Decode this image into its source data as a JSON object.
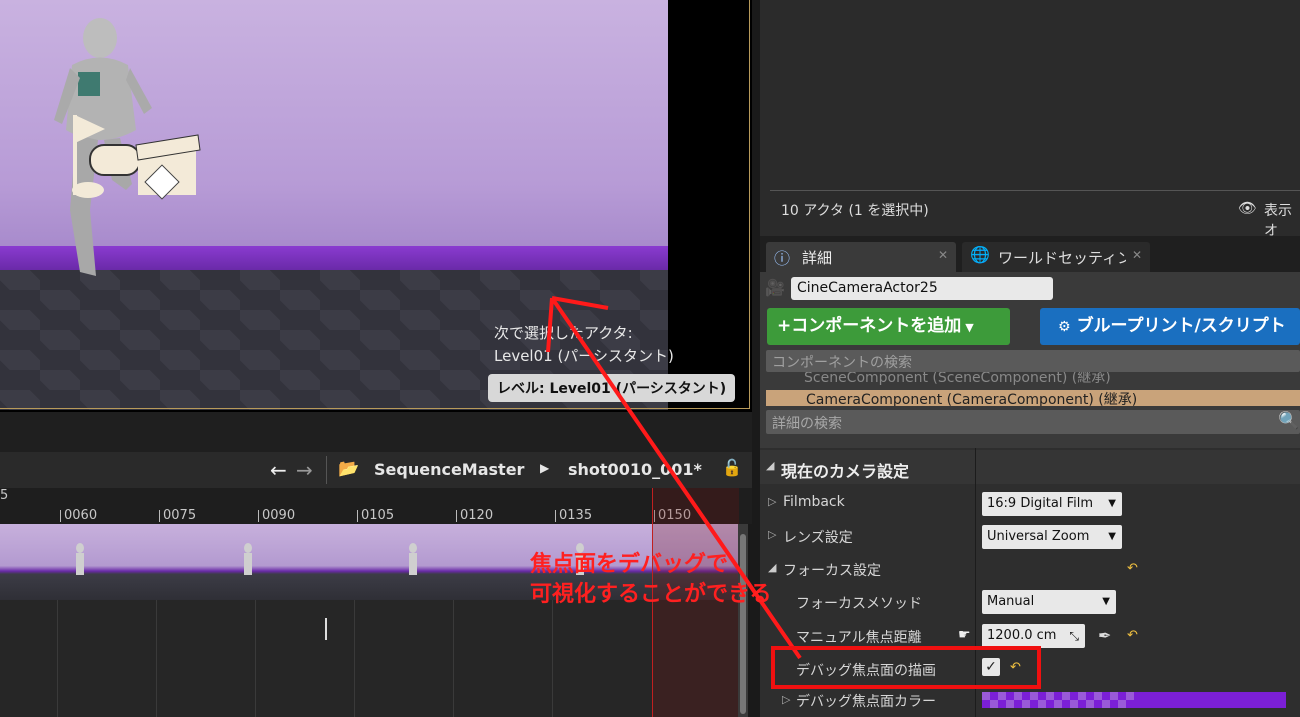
{
  "viewport": {
    "select_hint_line1": "次で選択したアクタ:",
    "select_hint_line2": "Level01 (パーシスタント)",
    "level_badge": "レベル: Level01 (パーシスタント)"
  },
  "sequencer": {
    "breadcrumb_root": "SequenceMaster",
    "breadcrumb_shot": "shot0010_001*",
    "ruler_start": "5",
    "ticks": [
      "0060",
      "0075",
      "0090",
      "0105",
      "0120",
      "0135",
      "0150"
    ]
  },
  "outliner": {
    "actor_count": "10 アクタ (1 を選択中)",
    "view_options": "表示オ"
  },
  "tabs": {
    "details": "詳細",
    "world_settings": "ワールドセッティング"
  },
  "details": {
    "actor_name": "CineCameraActor25",
    "add_component": "+コンポーネントを追加",
    "blueprint": "ブループリント/スクリプト",
    "component_search_placeholder": "コンポーネントの検索",
    "scene_component": "SceneComponent (SceneComponent) (継承)",
    "camera_component": "CameraComponent (CameraComponent) (継承)",
    "details_search_placeholder": "詳細の検索",
    "section_title": "現在のカメラ設定",
    "filmback_label": "Filmback",
    "filmback_value": "16:9 Digital Film",
    "lens_label": "レンズ設定",
    "lens_value": "Universal Zoom",
    "focus_label": "フォーカス設定",
    "focus_method_label": "フォーカスメソッド",
    "focus_method_value": "Manual",
    "manual_focus_label": "マニュアル焦点距離",
    "manual_focus_value": "1200.0 cm",
    "draw_debug_label": "デバッグ焦点面の描画",
    "debug_color_label": "デバッグ焦点面カラー"
  },
  "annotation": {
    "line1": "焦点面をデバッグで",
    "line2": "可視化することができる"
  },
  "colors": {
    "accent_green": "#3d9b3a",
    "accent_blue": "#1a6fc0",
    "annotation_red": "#ff2020",
    "debug_color": "#7b1fd6"
  }
}
